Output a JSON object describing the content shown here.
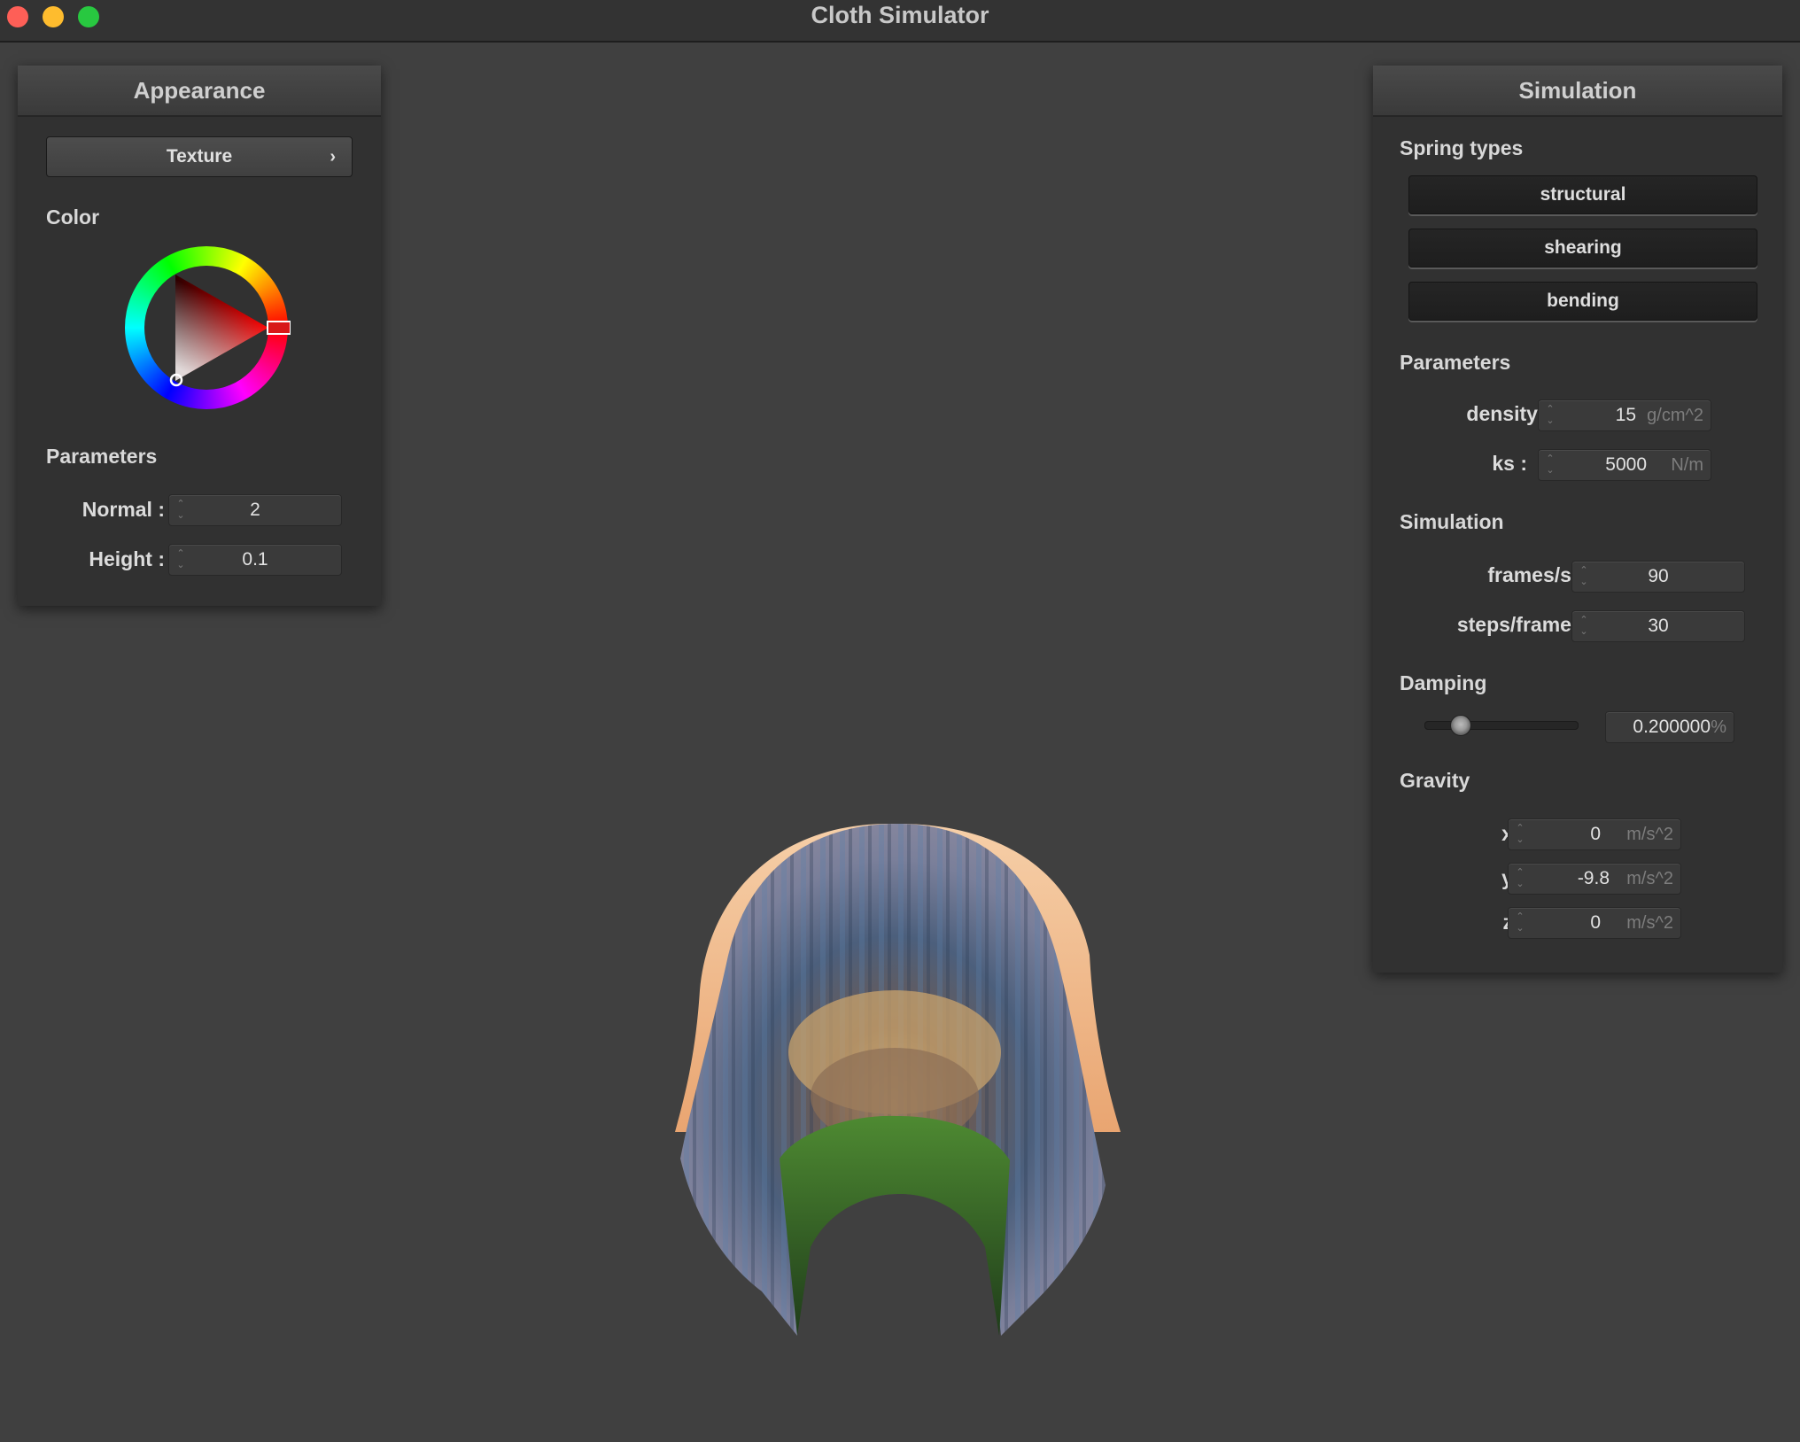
{
  "window": {
    "title": "Cloth Simulator"
  },
  "appearance": {
    "header": "Appearance",
    "texture_button": "Texture",
    "texture_chevron": "›",
    "color_label": "Color",
    "selected_color": "#ff0000",
    "parameters_label": "Parameters",
    "normal": {
      "label": "Normal :",
      "value": "2"
    },
    "height": {
      "label": "Height :",
      "value": "0.1"
    }
  },
  "simulation": {
    "header": "Simulation",
    "spring_types_label": "Spring types",
    "spring_types": [
      "structural",
      "shearing",
      "bending"
    ],
    "parameters_label": "Parameters",
    "density": {
      "label": "density :",
      "value": "15",
      "unit": "g/cm^2"
    },
    "ks": {
      "label": "ks :",
      "value": "5000",
      "unit": "N/m"
    },
    "simulation_label": "Simulation",
    "frames_per_s": {
      "label": "frames/s :",
      "value": "90"
    },
    "steps_per_frame": {
      "label": "steps/frame :",
      "value": "30"
    },
    "damping_label": "Damping",
    "damping": {
      "value": "0.200000",
      "unit": "%",
      "slider_fraction": 0.2
    },
    "gravity_label": "Gravity",
    "gravity": {
      "x": {
        "label": "x :",
        "value": "0",
        "unit": "m/s^2"
      },
      "y": {
        "label": "y :",
        "value": "-9.8",
        "unit": "m/s^2"
      },
      "z": {
        "label": "z :",
        "value": "0",
        "unit": "m/s^2"
      }
    }
  },
  "viewport": {
    "object": "textured cloth draped over sphere"
  }
}
